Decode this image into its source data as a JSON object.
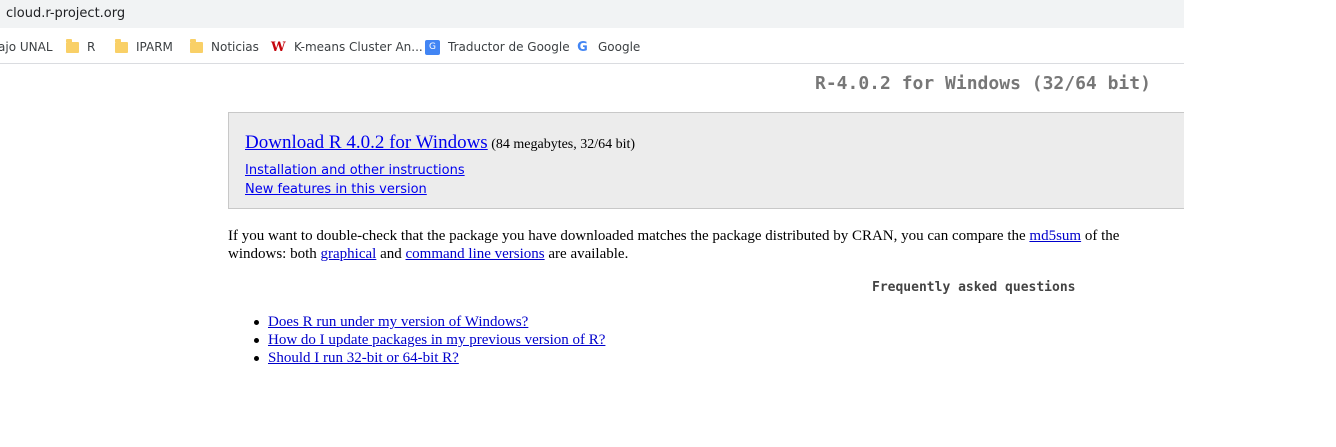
{
  "browser": {
    "url": "cloud.r-project.org",
    "bookmarks": [
      {
        "label": "ajo UNAL",
        "icon": "none"
      },
      {
        "label": "R",
        "icon": "folder-icon"
      },
      {
        "label": "IPARM",
        "icon": "folder-icon"
      },
      {
        "label": "Noticias",
        "icon": "folder-icon"
      },
      {
        "label": "K-means Cluster An...",
        "icon": "uw-logo-icon"
      },
      {
        "label": "Traductor de Google",
        "icon": "google-translate-icon"
      },
      {
        "label": "Google",
        "icon": "google-icon"
      }
    ]
  },
  "page": {
    "title": "R-4.0.2 for Windows (32/64 bit)",
    "download": {
      "link": "Download R 4.0.2 for Windows",
      "size": " (84 megabytes, 32/64 bit)",
      "install_link": "Installation and other instructions",
      "features_link": "New features in this version"
    },
    "paragraph": {
      "line1_a": "If you want to double-check that the package you have downloaded matches the package distributed by CRAN, you can compare the ",
      "md5_link": "md5sum",
      "line1_b": " of the",
      "line2_a": "windows: both ",
      "graphical_link": "graphical",
      "line2_b": " and ",
      "cmdline_link": "command line versions",
      "line2_c": " are available."
    },
    "faq_heading": "Frequently asked questions",
    "faq": [
      "Does R run under my version of Windows?",
      "How do I update packages in my previous version of R?",
      "Should I run 32-bit or 64-bit R?"
    ]
  },
  "colors": {
    "link": "#0000ee",
    "box_bg": "#ececec",
    "title_gray": "#777777"
  }
}
